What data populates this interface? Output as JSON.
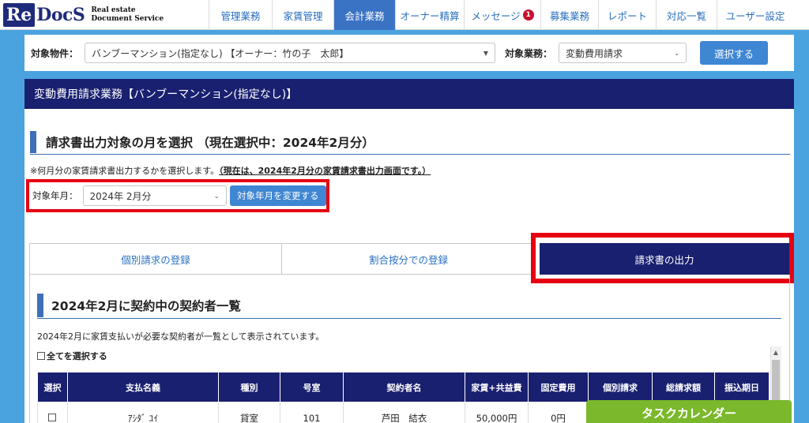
{
  "logo": {
    "re": "Re",
    "docs": "DocS",
    "tagline1": "Real estate",
    "tagline2": "Document Service"
  },
  "nav": {
    "items": [
      {
        "label": "管理業務"
      },
      {
        "label": "家賃管理"
      },
      {
        "label": "会計業務"
      },
      {
        "label": "オーナー精算"
      },
      {
        "label": "メッセージ",
        "badge": "1"
      },
      {
        "label": "募集業務"
      },
      {
        "label": "レポート"
      },
      {
        "label": "対応一覧"
      },
      {
        "label": "ユーザー設定"
      }
    ]
  },
  "selector": {
    "property_label": "対象物件：",
    "property_value": "バンブーマンション(指定なし) 【オーナー：竹の子　太郎】",
    "task_label": "対象業務：",
    "task_value": "変動費用請求",
    "select_button": "選択する"
  },
  "page": {
    "title": "変動費用請求業務【バンブーマンション(指定なし)】",
    "month_section_title": "請求書出力対象の月を選択 （現在選択中：2024年2月分）",
    "note_prefix": "※何月分の家賃請求書出力するかを選択します。",
    "note_underline": "（現在は、2024年2月分の家賃請求書出力画面です。）",
    "month_label": "対象年月：",
    "month_value": "2024年 2月分",
    "change_month_button": "対象年月を変更する"
  },
  "tabs": [
    {
      "label": "個別請求の登録"
    },
    {
      "label": "割合按分での登録"
    },
    {
      "label": "請求書の出力"
    }
  ],
  "list": {
    "title": "2024年2月に契約中の契約者一覧",
    "description": "2024年2月に家賃支払いが必要な契約者が一覧として表示されています。",
    "select_all": "全てを選択する",
    "columns": [
      "選択",
      "支払名義",
      "種別",
      "号室",
      "契約者名",
      "家賃+共益費",
      "固定費用",
      "個別請求",
      "総請求額",
      "振込期日"
    ],
    "rows": [
      {
        "payer": "ｱｼﾀﾞ ﾕｲ",
        "type": "貸室",
        "room": "101",
        "name": "芦田　結衣",
        "rent": "50,000円",
        "fixed": "0円",
        "individual": "",
        "total": "",
        "due": ""
      }
    ]
  },
  "task_calendar": "タスクカレンダー",
  "colors": {
    "nav_active": "#3b73c4",
    "header_navy": "#1a2070",
    "highlight_red": "#e60012",
    "task_green": "#7bb82b"
  }
}
